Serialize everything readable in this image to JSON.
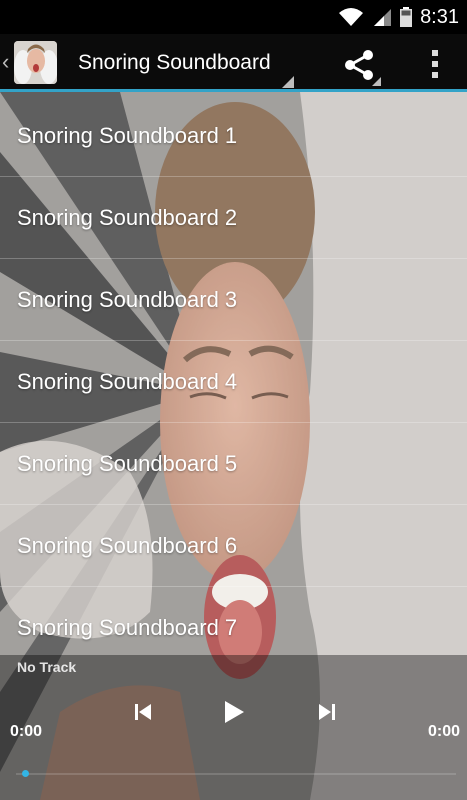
{
  "status_bar": {
    "time": "8:31"
  },
  "action_bar": {
    "title": "Snoring Soundboard"
  },
  "list": {
    "items": [
      {
        "label": "Snoring Soundboard 1"
      },
      {
        "label": "Snoring Soundboard 2"
      },
      {
        "label": "Snoring Soundboard 3"
      },
      {
        "label": "Snoring Soundboard 4"
      },
      {
        "label": "Snoring Soundboard 5"
      },
      {
        "label": "Snoring Soundboard 6"
      },
      {
        "label": "Snoring Soundboard 7"
      }
    ]
  },
  "player": {
    "track": "No Track",
    "elapsed": "0:00",
    "duration": "0:00",
    "progress": 0
  },
  "colors": {
    "accent": "#33a3c8",
    "seek_thumb": "#33b5e5"
  },
  "icons": [
    "wifi-icon",
    "signal-icon",
    "battery-icon",
    "share-icon",
    "overflow-menu-icon",
    "previous-icon",
    "play-icon",
    "next-icon"
  ]
}
